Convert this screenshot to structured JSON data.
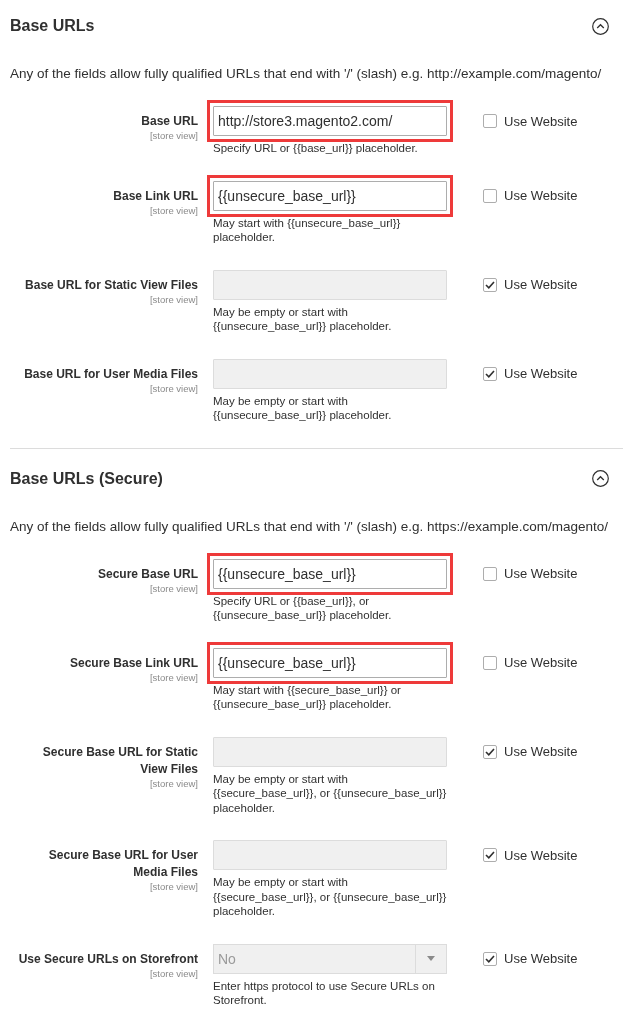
{
  "sections": [
    {
      "title": "Base URLs",
      "expanded": true,
      "description": "Any of the fields allow fully qualified URLs that end with '/' (slash) e.g. http://example.com/magento/",
      "rows": [
        {
          "kind": "text",
          "label": "Base URL",
          "scope": "[store view]",
          "value": "http://store3.magento2.com/",
          "disabled": false,
          "highlighted": true,
          "hint": "Specify URL or {{base_url}} placeholder.",
          "use_website": {
            "label": "Use Website",
            "checked": false
          }
        },
        {
          "kind": "text",
          "label": "Base Link URL",
          "scope": "[store view]",
          "value": "{{unsecure_base_url}}",
          "disabled": false,
          "highlighted": true,
          "hint": "May start with {{unsecure_base_url}} placeholder.",
          "use_website": {
            "label": "Use Website",
            "checked": false
          }
        },
        {
          "kind": "text",
          "label": "Base URL for Static View Files",
          "scope": "[store view]",
          "disabled": true,
          "highlighted": false,
          "hint": "May be empty or start with {{unsecure_base_url}} placeholder.",
          "use_website": {
            "label": "Use Website",
            "checked": true
          }
        },
        {
          "kind": "text",
          "label": "Base URL for User Media Files",
          "scope": "[store view]",
          "disabled": true,
          "highlighted": false,
          "hint": "May be empty or start with {{unsecure_base_url}} placeholder.",
          "use_website": {
            "label": "Use Website",
            "checked": true
          }
        }
      ]
    },
    {
      "title": "Base URLs (Secure)",
      "expanded": true,
      "description": "Any of the fields allow fully qualified URLs that end with '/' (slash) e.g. https://example.com/magento/",
      "rows": [
        {
          "kind": "text",
          "label": "Secure Base URL",
          "scope": "[store view]",
          "value": "{{unsecure_base_url}}",
          "disabled": false,
          "highlighted": true,
          "hint": "Specify URL or {{base_url}}, or {{unsecure_base_url}} placeholder.",
          "use_website": {
            "label": "Use Website",
            "checked": false
          }
        },
        {
          "kind": "text",
          "label": "Secure Base Link URL",
          "scope": "[store view]",
          "value": "{{unsecure_base_url}}",
          "disabled": false,
          "highlighted": true,
          "hint": "May start with {{secure_base_url}} or {{unsecure_base_url}} placeholder.",
          "use_website": {
            "label": "Use Website",
            "checked": false
          }
        },
        {
          "kind": "text",
          "label": "Secure Base URL for Static View Files",
          "scope": "[store view]",
          "disabled": true,
          "highlighted": false,
          "hint": "May be empty or start with {{secure_base_url}}, or {{unsecure_base_url}} placeholder.",
          "use_website": {
            "label": "Use Website",
            "checked": true
          }
        },
        {
          "kind": "text",
          "label": "Secure Base URL for User Media Files",
          "scope": "[store view]",
          "disabled": true,
          "highlighted": false,
          "hint": "May be empty or start with {{secure_base_url}}, or {{unsecure_base_url}} placeholder.",
          "use_website": {
            "label": "Use Website",
            "checked": true
          }
        },
        {
          "kind": "select",
          "label": "Use Secure URLs on Storefront",
          "scope": "[store view]",
          "value": "No",
          "disabled": true,
          "highlighted": false,
          "hint": "Enter https protocol to use Secure URLs on Storefront.",
          "use_website": {
            "label": "Use Website",
            "checked": true
          }
        }
      ]
    }
  ]
}
